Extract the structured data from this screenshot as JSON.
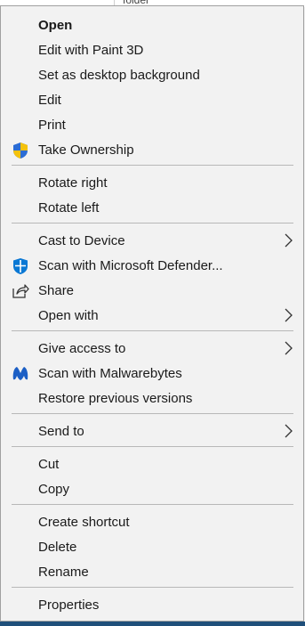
{
  "background": {
    "folder_text": "folder"
  },
  "menu": {
    "items": [
      {
        "label": "Open"
      },
      {
        "label": "Edit with Paint 3D"
      },
      {
        "label": "Set as desktop background"
      },
      {
        "label": "Edit"
      },
      {
        "label": "Print"
      },
      {
        "label": "Take Ownership",
        "icon": "uac-shield-icon"
      },
      {
        "label": "Rotate right"
      },
      {
        "label": "Rotate left"
      },
      {
        "label": "Cast to Device"
      },
      {
        "label": "Scan with Microsoft Defender...",
        "icon": "defender-icon"
      },
      {
        "label": "Share",
        "icon": "share-icon"
      },
      {
        "label": "Open with"
      },
      {
        "label": "Give access to"
      },
      {
        "label": "Scan with Malwarebytes",
        "icon": "malwarebytes-icon"
      },
      {
        "label": "Restore previous versions"
      },
      {
        "label": "Send to"
      },
      {
        "label": "Cut"
      },
      {
        "label": "Copy"
      },
      {
        "label": "Create shortcut"
      },
      {
        "label": "Delete"
      },
      {
        "label": "Rename"
      },
      {
        "label": "Properties"
      }
    ]
  },
  "colors": {
    "menu_background": "#f2f2f2",
    "text": "#1a1a1a",
    "separator": "#b8b8b8",
    "shield_blue": "#2b6cd4",
    "shield_yellow": "#f4c20d",
    "defender_blue": "#0a78d4",
    "malwarebytes_blue": "#1c5fc5",
    "taskbar": "#1f4f7a"
  }
}
